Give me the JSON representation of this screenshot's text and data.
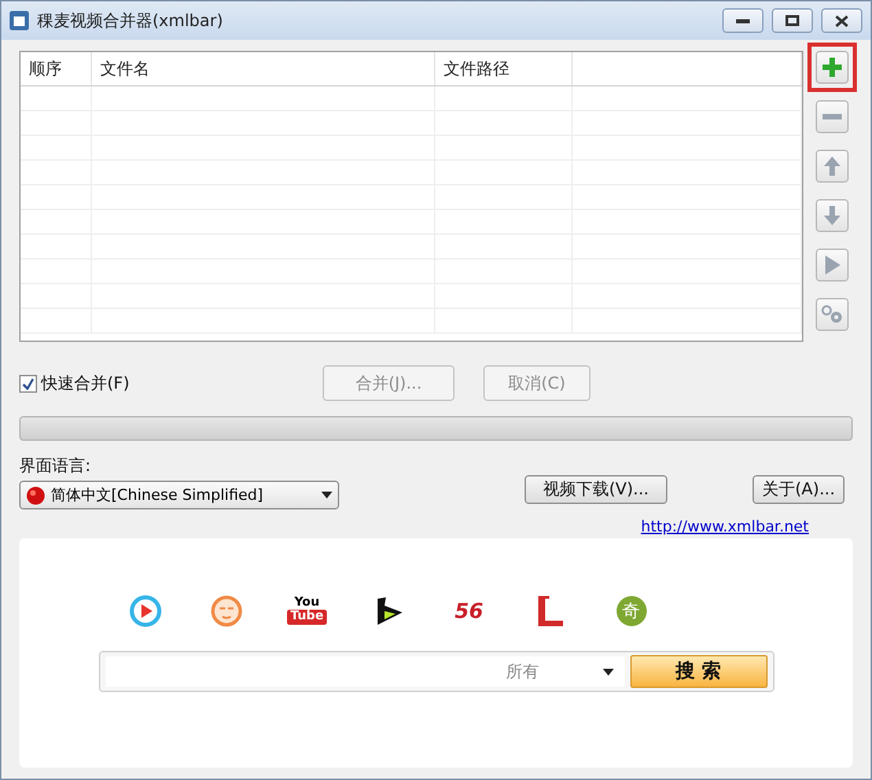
{
  "window": {
    "title": "稞麦视频合并器(xmlbar)"
  },
  "table": {
    "columns": [
      "顺序",
      "文件名",
      "文件路径"
    ]
  },
  "side_buttons": [
    {
      "kind": "add",
      "highlighted": true,
      "disabled": false
    },
    {
      "kind": "remove",
      "highlighted": false,
      "disabled": true
    },
    {
      "kind": "up",
      "highlighted": false,
      "disabled": true
    },
    {
      "kind": "down",
      "highlighted": false,
      "disabled": true
    },
    {
      "kind": "play",
      "highlighted": false,
      "disabled": true
    },
    {
      "kind": "settings",
      "highlighted": false,
      "disabled": true
    }
  ],
  "quick_merge": {
    "label": "快速合并(F)",
    "checked": true
  },
  "actions": [
    {
      "label": "合并(J)...",
      "disabled": true
    },
    {
      "label": "取消(C)",
      "disabled": true
    }
  ],
  "progress": {
    "level": 0
  },
  "language": {
    "label": "界面语言:",
    "value": "简体中文[Chinese Simplified]"
  },
  "buttons": [
    {
      "label": "视频下载(V)..."
    },
    {
      "label": "关于(A)..."
    }
  ],
  "link": "http://www.xmlbar.net",
  "sites": [
    {
      "kind": "play"
    },
    {
      "kind": "face"
    },
    {
      "kind": "youtube",
      "label": "You",
      "label2": "Tube"
    },
    {
      "kind": "chevron"
    },
    {
      "kind": "number",
      "label": "56"
    },
    {
      "kind": "bracket"
    },
    {
      "kind": "bubble",
      "label": "奇"
    }
  ],
  "search": {
    "scope": "所有",
    "button": "搜 索"
  }
}
